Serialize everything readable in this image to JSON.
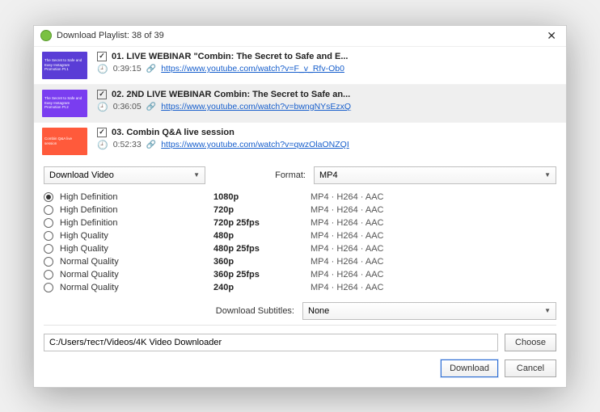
{
  "titlebar": {
    "text": "Download Playlist: 38 of 39"
  },
  "playlist": [
    {
      "checked": true,
      "title": "01. LIVE WEBINAR \"Combin: The Secret to Safe and E...",
      "duration": "0:39:15",
      "url": "https://www.youtube.com/watch?v=F_v_Rfv-Ob0",
      "thumb_bg": "#5a3dd6",
      "thumb_text": "The Secret to Safe and Easy Instagram Promotion Pt.1"
    },
    {
      "checked": true,
      "title": "02. 2ND LIVE WEBINAR Combin: The Secret to Safe an...",
      "duration": "0:36:05",
      "url": "https://www.youtube.com/watch?v=bwngNYsEzxQ",
      "thumb_bg": "#7a3df0",
      "thumb_text": "The Secret to Safe and Easy Instagram Promotion Pt.2"
    },
    {
      "checked": true,
      "title": "03. Combin Q&A live session",
      "duration": "0:52:33",
      "url": "https://www.youtube.com/watch?v=qwzOlaONZQI",
      "thumb_bg": "#ff5a3b",
      "thumb_text": "Combin Q&A live session"
    }
  ],
  "download_mode": "Download Video",
  "format_label": "Format:",
  "format_value": "MP4",
  "quality": [
    {
      "label": "High Definition",
      "res": "1080p",
      "codec": "MP4 · H264 · AAC",
      "selected": true
    },
    {
      "label": "High Definition",
      "res": "720p",
      "codec": "MP4 · H264 · AAC",
      "selected": false
    },
    {
      "label": "High Definition",
      "res": "720p 25fps",
      "codec": "MP4 · H264 · AAC",
      "selected": false
    },
    {
      "label": "High Quality",
      "res": "480p",
      "codec": "MP4 · H264 · AAC",
      "selected": false
    },
    {
      "label": "High Quality",
      "res": "480p 25fps",
      "codec": "MP4 · H264 · AAC",
      "selected": false
    },
    {
      "label": "Normal Quality",
      "res": "360p",
      "codec": "MP4 · H264 · AAC",
      "selected": false
    },
    {
      "label": "Normal Quality",
      "res": "360p 25fps",
      "codec": "MP4 · H264 · AAC",
      "selected": false
    },
    {
      "label": "Normal Quality",
      "res": "240p",
      "codec": "MP4 · H264 · AAC",
      "selected": false
    }
  ],
  "subtitles_label": "Download Subtitles:",
  "subtitles_value": "None",
  "path": "C:/Users/тест/Videos/4K Video Downloader",
  "buttons": {
    "choose": "Choose",
    "download": "Download",
    "cancel": "Cancel"
  }
}
